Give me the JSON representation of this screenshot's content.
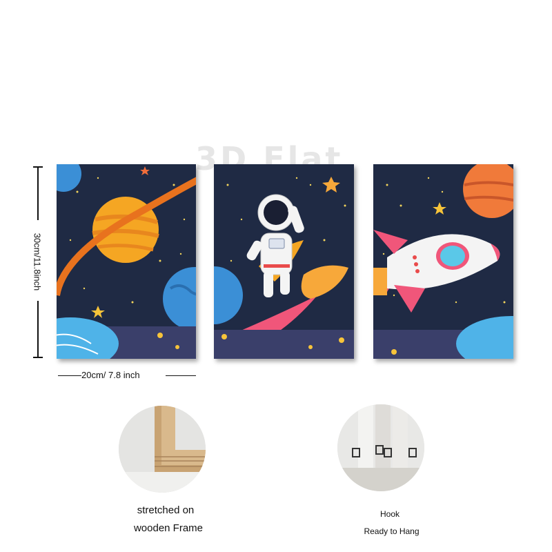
{
  "watermark": "3D Flat",
  "dimensions": {
    "height_label": "30cm/11.8inch",
    "width_label": "20cm/ 7.8 inch"
  },
  "features": [
    {
      "line1": "stretched on",
      "line2": "wooden Frame"
    },
    {
      "line1": "Hook",
      "line2": "Ready to Hang"
    }
  ],
  "colors": {
    "space_bg": "#1f2a44",
    "planet_orange": "#f5a623",
    "planet_blue": "#3b8fd6",
    "rocket_pink": "#f0567a"
  }
}
